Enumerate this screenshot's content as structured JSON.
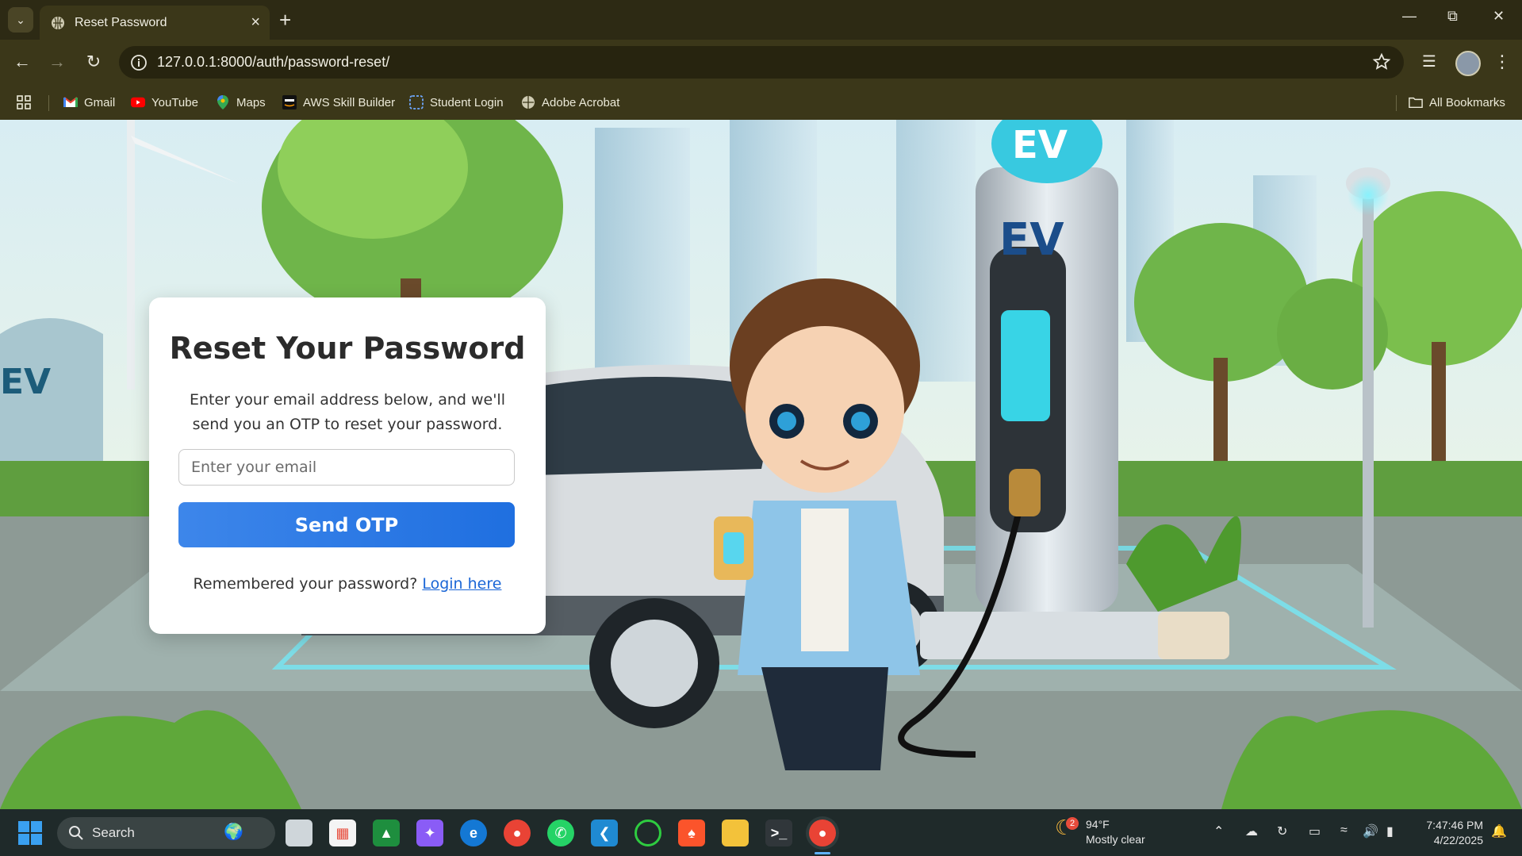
{
  "browser": {
    "tab_title": "Reset Password",
    "url": "127.0.0.1:8000/auth/password-reset/",
    "bookmarks": [
      {
        "label": "Gmail",
        "icon": "gmail-icon"
      },
      {
        "label": "YouTube",
        "icon": "youtube-icon"
      },
      {
        "label": "Maps",
        "icon": "maps-icon"
      },
      {
        "label": "AWS Skill Builder",
        "icon": "aws-icon"
      },
      {
        "label": "Student Login",
        "icon": "student-login-icon"
      },
      {
        "label": "Adobe Acrobat",
        "icon": "globe-icon"
      }
    ],
    "all_bookmarks": "All Bookmarks"
  },
  "page": {
    "title": "Reset Your Password",
    "description": "Enter your email address below, and we'll send you an OTP to reset your password.",
    "email_placeholder": "Enter your email",
    "email_value": "",
    "send_button": "Send OTP",
    "remember_text": "Remembered your password?",
    "login_link": "Login here",
    "illustration_sign": "EV",
    "illustration_sign2": "EV"
  },
  "taskbar": {
    "search_label": "Search",
    "weather_temp": "94°F",
    "weather_desc": "Mostly clear",
    "weather_badge": "2",
    "time": "7:47:46 PM",
    "date": "4/22/2025"
  },
  "colors": {
    "browser_frame": "#3b3719",
    "primary_button": "#2a78e4",
    "link": "#1a66d6"
  }
}
